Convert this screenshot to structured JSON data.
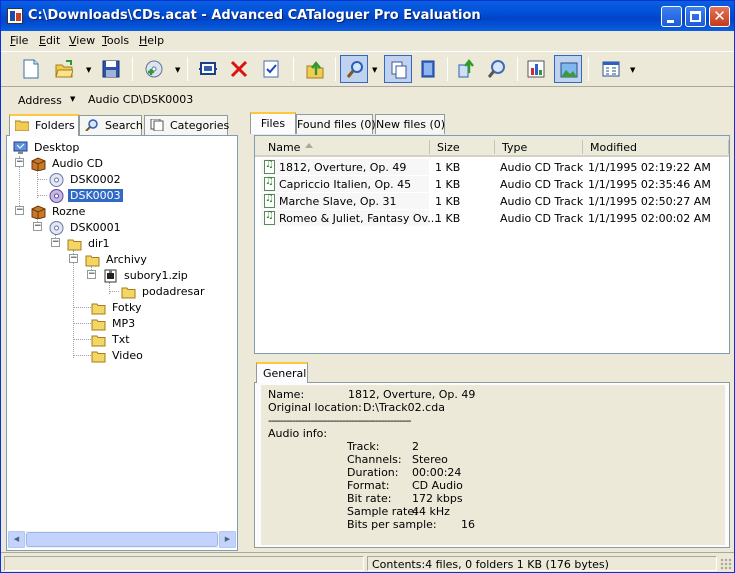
{
  "window": {
    "title": "C:\\Downloads\\CDs.acat - Advanced CATaloguer Pro Evaluation",
    "close_glyph": "✕"
  },
  "menu": [
    {
      "label": "File",
      "accel": "F",
      "rest": "ile"
    },
    {
      "label": "Edit",
      "accel": "E",
      "rest": "dit"
    },
    {
      "label": "View",
      "accel": "V",
      "rest": "iew"
    },
    {
      "label": "Tools",
      "accel": "T",
      "rest": "ools"
    },
    {
      "label": "Help",
      "accel": "H",
      "rest": "elp"
    }
  ],
  "toolbar": {
    "icons": [
      "new-document-icon",
      "open-folder-icon",
      "save-disk-icon",
      "add-disk-icon",
      "scan-icon",
      "delete-icon",
      "properties-icon",
      "up-folder-icon",
      "find-icon",
      "copy-icon",
      "book-icon",
      "import-icon",
      "search-globe-icon",
      "report-icon",
      "thumbnail-icon",
      "view-mode-icon"
    ],
    "dropdown_glyph": "▼"
  },
  "address": {
    "label": "Address",
    "value": "Audio CD\\DSK0003",
    "dropdown_glyph": "▼"
  },
  "left_tabs": [
    {
      "label": "Folders",
      "active": true
    },
    {
      "label": "Search",
      "active": false
    },
    {
      "label": "Categories",
      "active": false
    }
  ],
  "tree": {
    "expander_minus": "−",
    "nodes": [
      {
        "label": "Desktop",
        "icon": "desktop-icon",
        "selected": false
      },
      {
        "label": "Audio CD",
        "icon": "category-box-icon",
        "selected": false
      },
      {
        "label": "DSK0002",
        "icon": "cd-disk-icon",
        "selected": false
      },
      {
        "label": "DSK0003",
        "icon": "cd-disk-icon",
        "selected": true
      },
      {
        "label": "Rozne",
        "icon": "category-box-icon",
        "selected": false
      },
      {
        "label": "DSK0001",
        "icon": "cd-disk-icon",
        "selected": false
      },
      {
        "label": "dir1",
        "icon": "folder-icon",
        "selected": false
      },
      {
        "label": "Archivy",
        "icon": "folder-icon",
        "selected": false
      },
      {
        "label": "subory1.zip",
        "icon": "zip-file-icon",
        "selected": false
      },
      {
        "label": "podadresar",
        "icon": "folder-icon",
        "selected": false
      },
      {
        "label": "Fotky",
        "icon": "folder-icon",
        "selected": false
      },
      {
        "label": "MP3",
        "icon": "folder-icon",
        "selected": false
      },
      {
        "label": "Txt",
        "icon": "folder-icon",
        "selected": false
      },
      {
        "label": "Video",
        "icon": "folder-icon",
        "selected": false
      }
    ]
  },
  "scrollbar": {
    "left_arrow": "◀",
    "right_arrow": "▶"
  },
  "right_tabs": [
    {
      "label": "Files",
      "active": true
    },
    {
      "label": "Found files (0)",
      "active": false
    },
    {
      "label": "New files (0)",
      "active": false
    }
  ],
  "files": {
    "columns": [
      "Name",
      "Size",
      "Type",
      "Modified"
    ],
    "rows": [
      {
        "name": "1812, Overture, Op. 49",
        "size": "1 KB",
        "type": "Audio CD Track",
        "modified": "1/1/1995 02:19:22 AM"
      },
      {
        "name": "Capriccio Italien, Op. 45",
        "size": "1 KB",
        "type": "Audio CD Track",
        "modified": "1/1/1995 02:35:46 AM"
      },
      {
        "name": "Marche Slave, Op. 31",
        "size": "1 KB",
        "type": "Audio CD Track",
        "modified": "1/1/1995 02:50:27 AM"
      },
      {
        "name": "Romeo & Juliet, Fantasy Ov...",
        "size": "1 KB",
        "type": "Audio CD Track",
        "modified": "1/1/1995 02:00:02 AM"
      }
    ]
  },
  "general": {
    "tab_label": "General",
    "name_label": "Name:",
    "name_value": "1812, Overture, Op. 49",
    "location_label": "Original location:",
    "location_value": "D:\\Track02.cda",
    "divider": "------------------------------------------------",
    "audio_label": "Audio info:",
    "audio": [
      {
        "label": "Track:",
        "value": "2"
      },
      {
        "label": "Channels:",
        "value": "Stereo"
      },
      {
        "label": "Duration:",
        "value": "00:00:24"
      },
      {
        "label": "Format:",
        "value": "CD Audio"
      },
      {
        "label": "Bit rate:",
        "value": "172 kbps"
      },
      {
        "label": "Sample rate:",
        "value": "44 kHz"
      },
      {
        "label": "Bits per sample:",
        "value": "16"
      }
    ]
  },
  "status": {
    "contents": "Contents:4 files, 0 folders 1 KB (176 bytes)"
  },
  "colors": {
    "title_blue": "#0050d8",
    "selection": "#316ac5",
    "tab_highlight": "#ffc83c",
    "window_bg": "#ece9d8"
  }
}
